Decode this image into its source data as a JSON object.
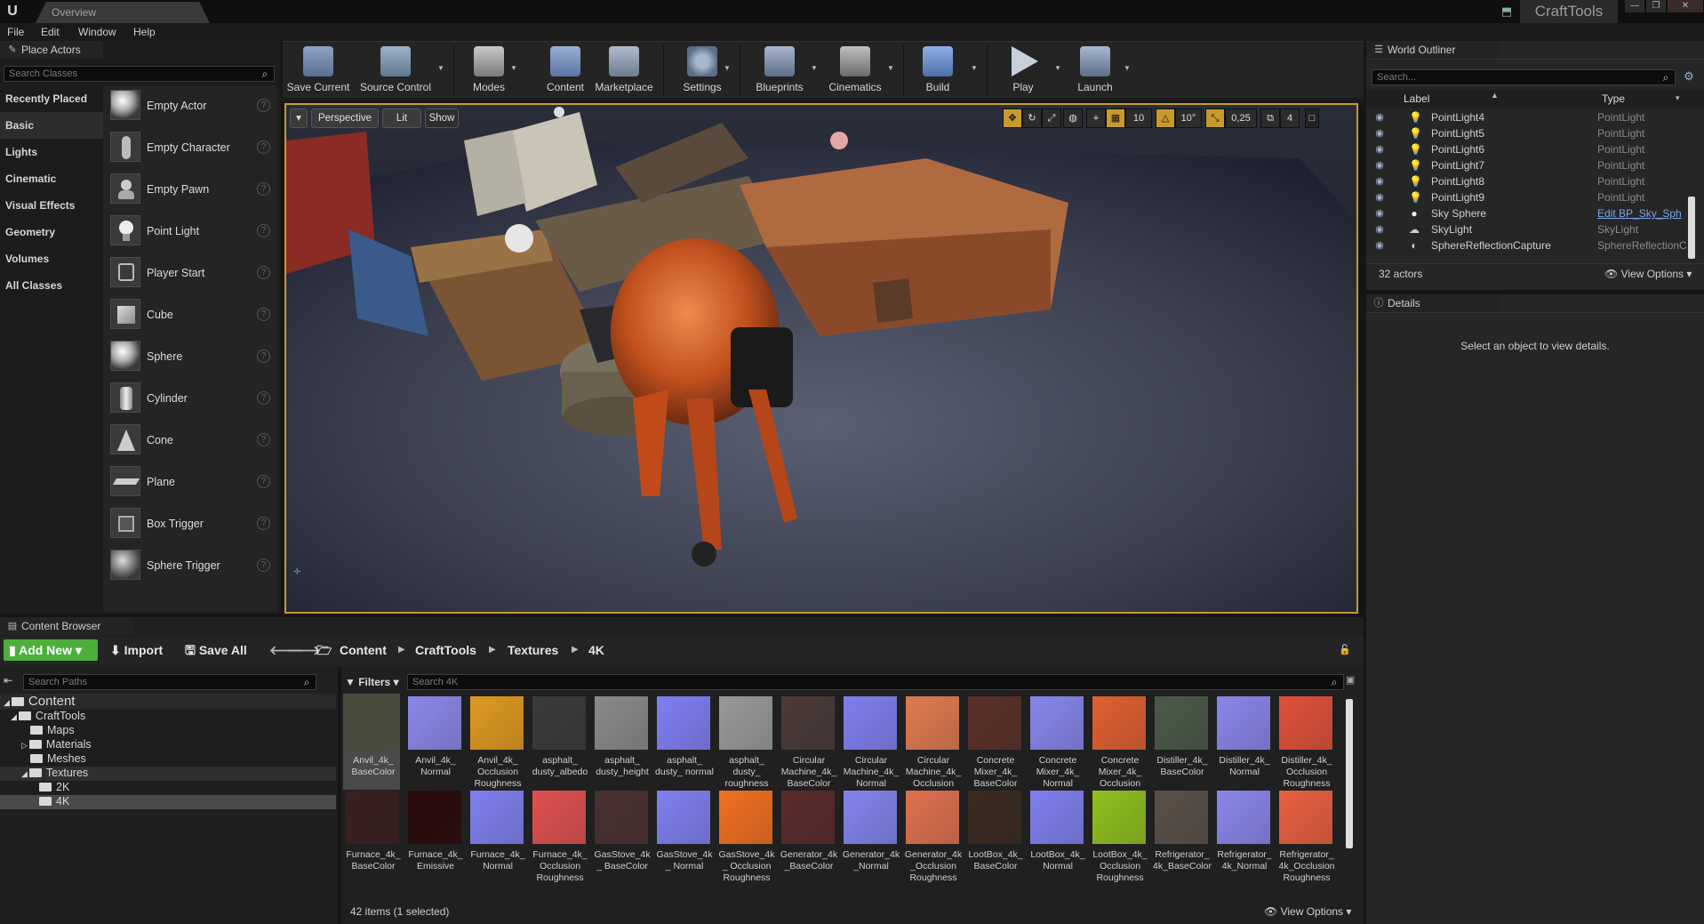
{
  "titlebar": {
    "tab": "Overview",
    "project": "CraftTools"
  },
  "menu": [
    "File",
    "Edit",
    "Window",
    "Help"
  ],
  "place_actors": {
    "tab": "Place Actors",
    "search_placeholder": "Search Classes",
    "categories": [
      "Recently Placed",
      "Basic",
      "Lights",
      "Cinematic",
      "Visual Effects",
      "Geometry",
      "Volumes",
      "All Classes"
    ],
    "selected_category": "Basic",
    "items": [
      {
        "label": "Empty Actor",
        "icon": "sphere-icon"
      },
      {
        "label": "Empty Character",
        "icon": "character-icon"
      },
      {
        "label": "Empty Pawn",
        "icon": "pawn-icon"
      },
      {
        "label": "Point Light",
        "icon": "light-bulb-icon"
      },
      {
        "label": "Player Start",
        "icon": "player-start-icon"
      },
      {
        "label": "Cube",
        "icon": "cube-icon"
      },
      {
        "label": "Sphere",
        "icon": "sphere-icon"
      },
      {
        "label": "Cylinder",
        "icon": "cylinder-icon"
      },
      {
        "label": "Cone",
        "icon": "cone-icon"
      },
      {
        "label": "Plane",
        "icon": "plane-icon"
      },
      {
        "label": "Box Trigger",
        "icon": "box-trigger-icon"
      },
      {
        "label": "Sphere Trigger",
        "icon": "sphere-trigger-icon"
      }
    ],
    "help_glyph": "?"
  },
  "toolbar": [
    {
      "label": "Save Current",
      "icon": "save-icon",
      "color": "#7a8fb0"
    },
    {
      "label": "Source Control",
      "icon": "source-control-icon",
      "color": "#6f8ea8"
    },
    {
      "label": "Modes",
      "icon": "modes-icon",
      "color": "#8c8c8c"
    },
    {
      "label": "Content",
      "icon": "content-icon",
      "color": "#6f87b0"
    },
    {
      "label": "Marketplace",
      "icon": "marketplace-icon",
      "color": "#7f8aa0"
    },
    {
      "label": "Settings",
      "icon": "settings-icon",
      "color": "#6d7f98"
    },
    {
      "label": "Blueprints",
      "icon": "blueprints-icon",
      "color": "#7f8fa8"
    },
    {
      "label": "Cinematics",
      "icon": "cinematics-icon",
      "color": "#8a8a8a"
    },
    {
      "label": "Build",
      "icon": "build-icon",
      "color": "#6d8cbd"
    },
    {
      "label": "Play",
      "icon": "play-icon",
      "color": "#8a95a8"
    },
    {
      "label": "Launch",
      "icon": "launch-icon",
      "color": "#7a8aa0"
    }
  ],
  "viewport": {
    "perspective": "Perspective",
    "lit": "Lit",
    "show": "Show",
    "grid_snap": "10",
    "rotation_snap": "10°",
    "scale_snap": "0,25",
    "camera_speed": "4",
    "accent": "#c79a2b"
  },
  "outliner": {
    "tab": "World Outliner",
    "search_placeholder": "Search...",
    "col_label": "Label",
    "col_type": "Type",
    "rows": [
      {
        "label": "PointLight4",
        "type": "PointLight",
        "icon": "point-light-icon"
      },
      {
        "label": "PointLight5",
        "type": "PointLight",
        "icon": "point-light-icon"
      },
      {
        "label": "PointLight6",
        "type": "PointLight",
        "icon": "point-light-icon"
      },
      {
        "label": "PointLight7",
        "type": "PointLight",
        "icon": "point-light-icon"
      },
      {
        "label": "PointLight8",
        "type": "PointLight",
        "icon": "point-light-icon"
      },
      {
        "label": "PointLight9",
        "type": "PointLight",
        "icon": "point-light-icon"
      },
      {
        "label": "Sky Sphere",
        "type": "Edit BP_Sky_Sph",
        "icon": "sky-sphere-icon",
        "link": true
      },
      {
        "label": "SkyLight",
        "type": "SkyLight",
        "icon": "sky-light-icon"
      },
      {
        "label": "SphereReflectionCapture",
        "type": "SphereReflectionC",
        "icon": "reflection-capture-icon"
      }
    ],
    "count": "32 actors",
    "view_options": "View Options"
  },
  "details": {
    "tab": "Details",
    "empty_message": "Select an object to view details."
  },
  "content_browser": {
    "tab": "Content Browser",
    "add_new": "Add New",
    "import": "Import",
    "save_all": "Save All",
    "breadcrumb": [
      "Content",
      "CraftTools",
      "Textures",
      "4K"
    ],
    "search_paths_placeholder": "Search Paths",
    "filters": "Filters",
    "search_placeholder": "Search 4K",
    "tree": [
      {
        "label": "Content",
        "level": 0
      },
      {
        "label": "CraftTools",
        "level": 1
      },
      {
        "label": "Maps",
        "level": 2
      },
      {
        "label": "Materials",
        "level": 2
      },
      {
        "label": "Meshes",
        "level": 2
      },
      {
        "label": "Textures",
        "level": 2
      },
      {
        "label": "2K",
        "level": 3
      },
      {
        "label": "4K",
        "level": 3,
        "selected": true
      }
    ],
    "assets_row1": [
      {
        "label": "Anvil_4k_ BaseColor",
        "color": "#4a4a3a",
        "selected": true
      },
      {
        "label": "Anvil_4k_ Normal",
        "color": "#8a88e8"
      },
      {
        "label": "Anvil_4k_ Occlusion Roughness",
        "color": "#e09a20"
      },
      {
        "label": "asphalt_ dusty_albedo",
        "color": "#3a3a3a"
      },
      {
        "label": "asphalt_ dusty_height",
        "color": "#8a8a8a"
      },
      {
        "label": "asphalt_ dusty_ normal",
        "color": "#7f7ff5"
      },
      {
        "label": "asphalt_ dusty_ roughness",
        "color": "#9a9a9a"
      },
      {
        "label": "Circular Machine_4k_ BaseColor",
        "color": "#4a3a38"
      },
      {
        "label": "Circular Machine_4k_ Normal",
        "color": "#7f80f0"
      },
      {
        "label": "Circular Machine_4k_ Occlusion",
        "color": "#e07a50"
      },
      {
        "label": "Concrete Mixer_4k_ BaseColor",
        "color": "#5a3028"
      },
      {
        "label": "Concrete Mixer_4k_ Normal",
        "color": "#8686ec"
      },
      {
        "label": "Concrete Mixer_4k_ Occlusion",
        "color": "#e06030"
      },
      {
        "label": "Distiller_4k_ BaseColor",
        "color": "#4a5a48"
      },
      {
        "label": "Distiller_4k_ Normal",
        "color": "#8a86ea"
      },
      {
        "label": "Distiller_4k_ Occlusion Roughness",
        "color": "#e0503a"
      }
    ],
    "assets_row2": [
      {
        "label": "Furnace_4k_ BaseColor",
        "color": "#3a2020"
      },
      {
        "label": "Furnace_4k_ Emissive",
        "color": "#2a0a0a"
      },
      {
        "label": "Furnace_4k_ Normal",
        "color": "#7f80f0"
      },
      {
        "label": "Furnace_4k_ Occlusion Roughness",
        "color": "#e05050"
      },
      {
        "label": "GasStove_4k_ BaseColor",
        "color": "#4a3030"
      },
      {
        "label": "GasStove_4k_ Normal",
        "color": "#7f80f0"
      },
      {
        "label": "GasStove_4k_ Occlusion Roughness",
        "color": "#f07020"
      },
      {
        "label": "Generator_4k _BaseColor",
        "color": "#5a2a2a"
      },
      {
        "label": "Generator_4k _Normal",
        "color": "#8284ee"
      },
      {
        "label": "Generator_4k _Occlusion Roughness",
        "color": "#e07050"
      },
      {
        "label": "LootBox_4k_ BaseColor",
        "color": "#3a2a20"
      },
      {
        "label": "LootBox_4k_ Normal",
        "color": "#7f80f0"
      },
      {
        "label": "LootBox_4k_ Occlusion Roughness",
        "color": "#90c020"
      },
      {
        "label": "Refrigerator_ 4k_BaseColor",
        "color": "#5a5048"
      },
      {
        "label": "Refrigerator_ 4k_Normal",
        "color": "#8a86ea"
      },
      {
        "label": "Refrigerator_ 4k_Occlusion Roughness",
        "color": "#e86040"
      }
    ],
    "status": "42 items (1 selected)",
    "view_options": "View Options",
    "accent_green": "#4caf3c"
  }
}
